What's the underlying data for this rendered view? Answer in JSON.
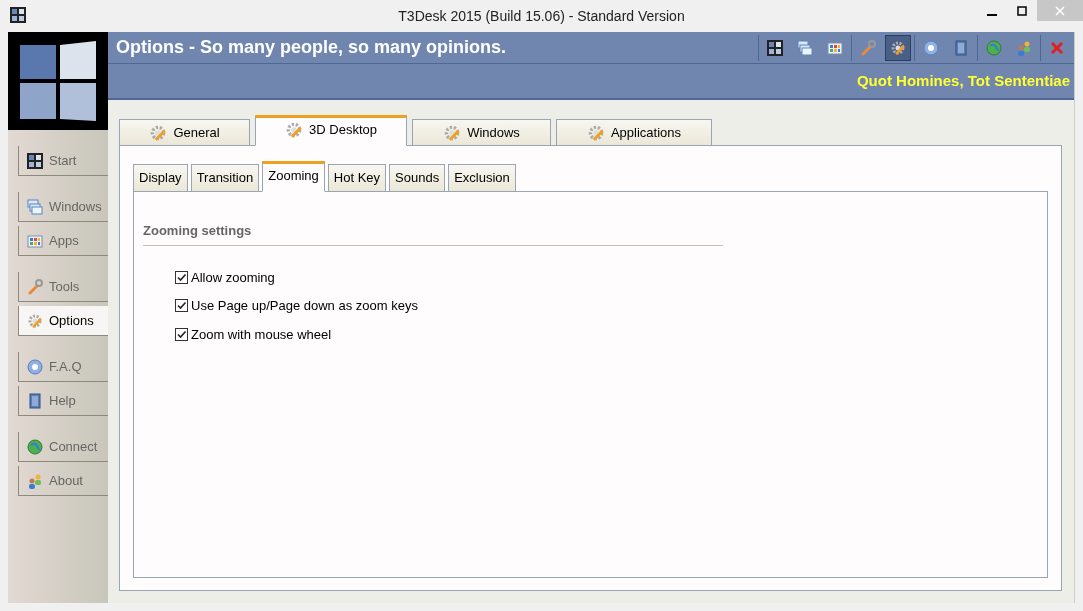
{
  "window": {
    "title": "T3Desk 2015 (Build 15.06) - Standard Version"
  },
  "header": {
    "title": "Options - So many people, so many opinions.",
    "motto": "Quot Homines, Tot Sententiae"
  },
  "toolbar": [
    {
      "kind": "start",
      "selected": false
    },
    {
      "kind": "windows",
      "selected": false
    },
    {
      "kind": "apps",
      "selected": false
    },
    {
      "kind": "tools",
      "selected": false
    },
    {
      "kind": "options",
      "selected": true
    },
    {
      "kind": "faq",
      "selected": false
    },
    {
      "kind": "help",
      "selected": false
    },
    {
      "kind": "connect",
      "selected": false
    },
    {
      "kind": "about",
      "selected": false
    },
    {
      "kind": "close",
      "selected": false
    }
  ],
  "sidebar": {
    "groups": [
      [
        {
          "label": "Start",
          "kind": "start",
          "selected": false
        }
      ],
      [
        {
          "label": "Windows",
          "kind": "windows",
          "selected": false
        },
        {
          "label": "Apps",
          "kind": "apps",
          "selected": false
        }
      ],
      [
        {
          "label": "Tools",
          "kind": "tools",
          "selected": false
        },
        {
          "label": "Options",
          "kind": "options",
          "selected": true
        }
      ],
      [
        {
          "label": "F.A.Q",
          "kind": "faq",
          "selected": false
        },
        {
          "label": "Help",
          "kind": "help",
          "selected": false
        }
      ],
      [
        {
          "label": "Connect",
          "kind": "connect",
          "selected": false
        },
        {
          "label": "About",
          "kind": "about",
          "selected": false
        }
      ]
    ]
  },
  "tabs": [
    {
      "label": "General",
      "selected": false
    },
    {
      "label": "3D Desktop",
      "selected": true
    },
    {
      "label": "Windows",
      "selected": false
    },
    {
      "label": "Applications",
      "selected": false
    }
  ],
  "subtabs": [
    {
      "label": "Display",
      "selected": false
    },
    {
      "label": "Transition",
      "selected": false
    },
    {
      "label": "Zooming",
      "selected": true
    },
    {
      "label": "Hot Key",
      "selected": false
    },
    {
      "label": "Sounds",
      "selected": false
    },
    {
      "label": "Exclusion",
      "selected": false
    }
  ],
  "section": {
    "title": "Zooming settings",
    "options": [
      {
        "label": "Allow zooming",
        "checked": true
      },
      {
        "label": "Use Page up/Page down as zoom keys",
        "checked": true
      },
      {
        "label": "Zoom with mouse wheel",
        "checked": true
      }
    ]
  }
}
